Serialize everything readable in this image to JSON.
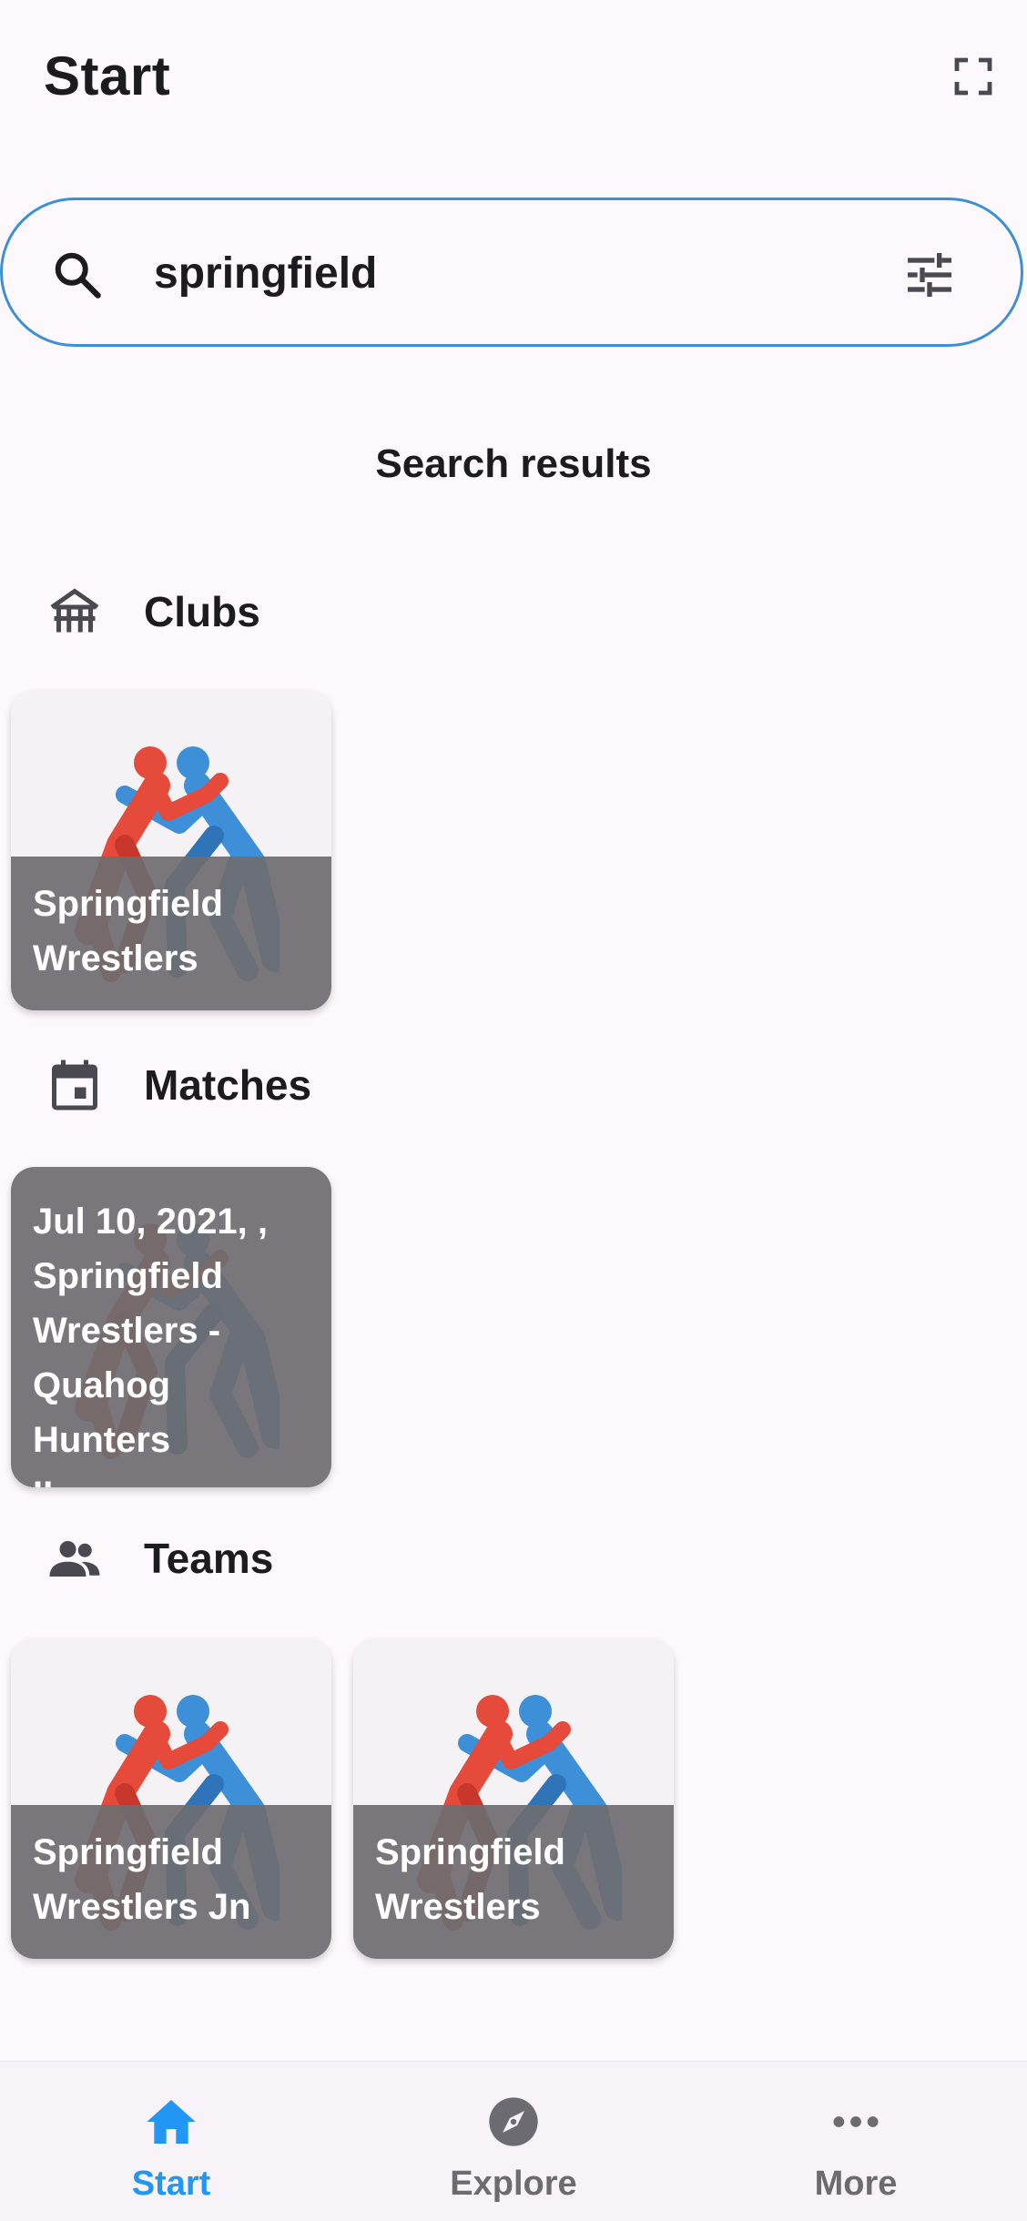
{
  "header": {
    "title": "Start"
  },
  "search": {
    "query": "springfield",
    "placeholder": ""
  },
  "results": {
    "heading": "Search results",
    "clubs": {
      "label": "Clubs",
      "items": [
        {
          "line1": "Springfield",
          "line2": "Wrestlers"
        }
      ]
    },
    "matches": {
      "label": "Matches",
      "items": [
        {
          "lines": [
            "Jul 10, 2021, ,",
            "Springfield",
            "Wrestlers -",
            "Quahog Hunters",
            "II"
          ]
        }
      ]
    },
    "teams": {
      "label": "Teams",
      "items": [
        {
          "line1": "Springfield",
          "line2": "Wrestlers Jn"
        },
        {
          "line1": "Springfield",
          "line2": "Wrestlers"
        }
      ]
    }
  },
  "bottom_nav": {
    "items": [
      {
        "label": "Start",
        "icon": "home-icon",
        "active": true
      },
      {
        "label": "Explore",
        "icon": "compass-icon",
        "active": false
      },
      {
        "label": "More",
        "icon": "more-horiz-icon",
        "active": false
      }
    ]
  },
  "colors": {
    "accent": "#2196f3",
    "search_border": "#3d8fd8",
    "wrestler_red": "#e64a3b",
    "wrestler_blue": "#3d8fd8",
    "card_overlay": "#6e6c70",
    "background": "#fcf8fc"
  }
}
